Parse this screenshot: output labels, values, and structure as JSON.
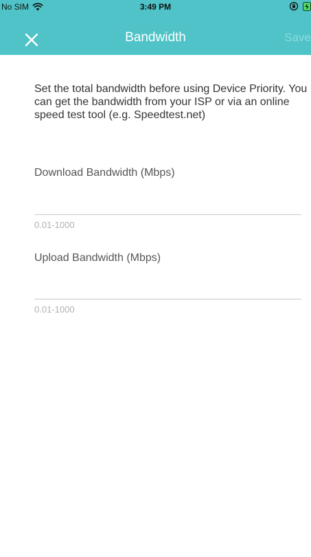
{
  "status_bar": {
    "carrier": "No SIM",
    "time": "3:49 PM"
  },
  "nav": {
    "title": "Bandwidth",
    "save_label": "Save"
  },
  "description": "Set the total bandwidth before using Device Priority. You can get the bandwidth from your ISP or via an online speed test tool (e.g. Speedtest.net)",
  "download": {
    "label": "Download Bandwidth (Mbps)",
    "value": "",
    "hint": "0.01-1000"
  },
  "upload": {
    "label": "Upload Bandwidth (Mbps)",
    "value": "",
    "hint": "0.01-1000"
  },
  "colors": {
    "header": "#4fc3c7",
    "title": "#ffffff",
    "save_disabled": "#8fdbde",
    "hint": "#b0b0b0"
  }
}
